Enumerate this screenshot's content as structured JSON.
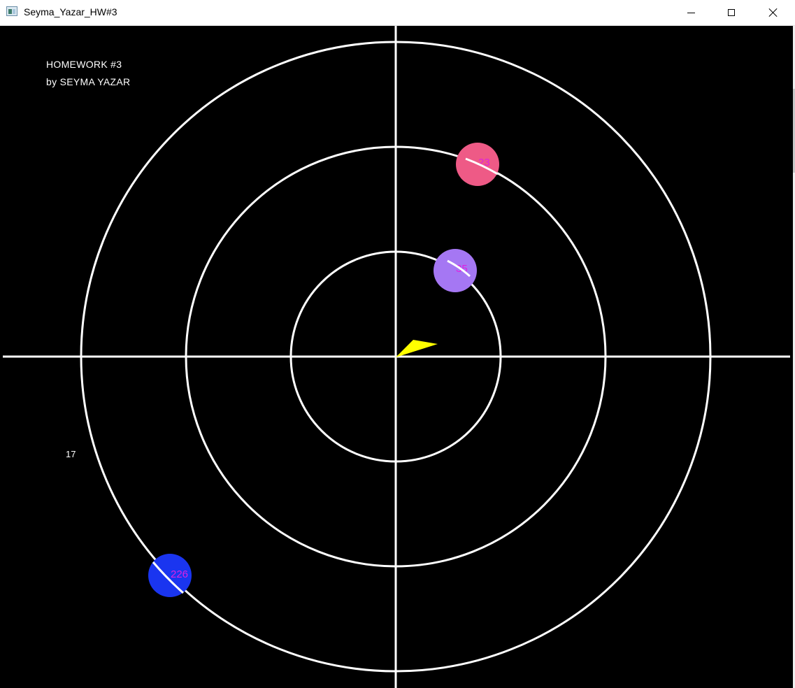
{
  "window": {
    "title": "Seyma_Yazar_HW#3",
    "controls": {
      "minimize": "minimize-icon",
      "maximize": "maximize-icon",
      "close": "close-icon"
    }
  },
  "hud": {
    "title": "HOMEWORK #3",
    "author": "by SEYMA YAZAR",
    "counter": "17"
  },
  "colors": {
    "background": "#000000",
    "rings": "#ffffff",
    "axes": "#ffffff",
    "pointer": "#ffff00",
    "label": "#e020e0"
  },
  "targets": [
    {
      "label": "23",
      "color": "#ee5a86"
    },
    {
      "label": "35",
      "color": "#a577f3"
    },
    {
      "label": "226",
      "color": "#1a35f0"
    }
  ]
}
